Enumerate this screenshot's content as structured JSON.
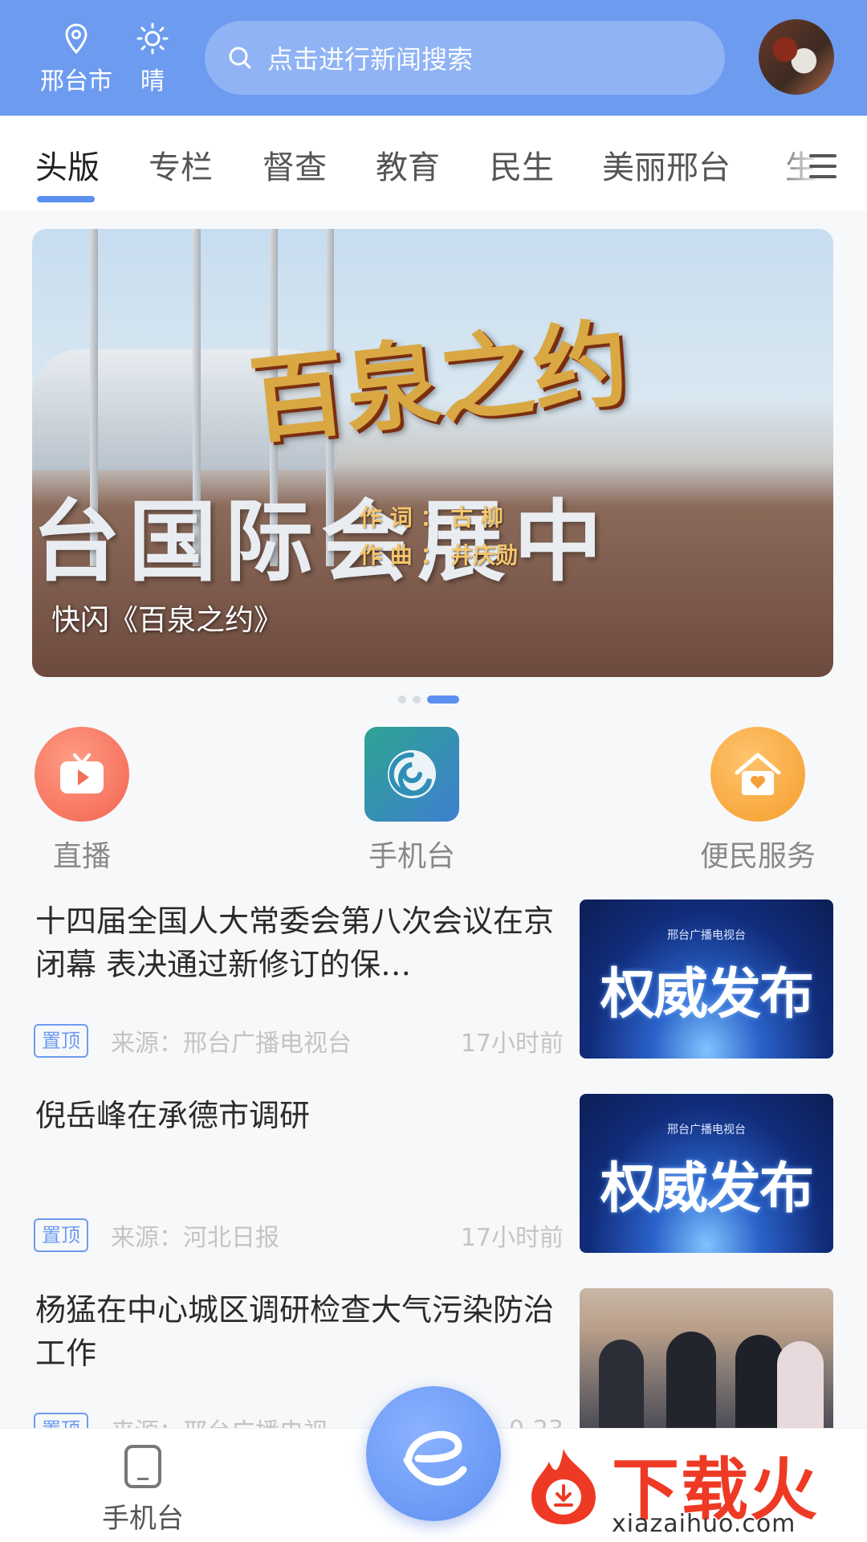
{
  "header": {
    "location_icon": "map-pin-icon",
    "city": "邢台市",
    "weather_icon": "sun-icon",
    "weather": "晴",
    "search_icon": "search-icon",
    "search_placeholder": "点击进行新闻搜索",
    "accent_color": "#6d9bf0"
  },
  "tabs": {
    "items": [
      {
        "label": "头版",
        "active": true
      },
      {
        "label": "专栏"
      },
      {
        "label": "督查"
      },
      {
        "label": "教育"
      },
      {
        "label": "民生"
      },
      {
        "label": "美丽邢台"
      },
      {
        "label": "生"
      }
    ],
    "menu_icon": "menu-icon"
  },
  "banner": {
    "headline_art": "百泉之约",
    "sign_art": "台国际会展中",
    "credit_lyrics": "作 词 ： 古 柳",
    "credit_music": "作 曲 ： 井庆勋",
    "caption": "快闪《百泉之约》",
    "slide_count": 3,
    "active_slide": 3
  },
  "shortcuts": [
    {
      "label": "直播",
      "icon": "tv-play-icon"
    },
    {
      "label": "手机台",
      "icon": "spiral-app-icon"
    },
    {
      "label": "便民服务",
      "icon": "house-heart-icon"
    }
  ],
  "news": [
    {
      "title": "十四届全国人大常委会第八次会议在京闭幕 表决通过新修订的保…",
      "badge": "置顶",
      "source": "来源：邢台广播电视台",
      "time": "17小时前",
      "thumb_logo": "邢台广播电视台",
      "thumb_text": "权威发布"
    },
    {
      "title": "倪岳峰在承德市调研",
      "badge": "置顶",
      "source": "来源：河北日报",
      "time": "17小时前",
      "thumb_logo": "邢台广播电视台",
      "thumb_text": "权威发布"
    },
    {
      "title": "杨猛在中心城区调研检查大气污染防治工作",
      "badge": "置顶",
      "source": "来源：邢台广播电视",
      "time": "0-23"
    }
  ],
  "bottom_nav": {
    "items": [
      {
        "label": "手机台",
        "icon": "phone-icon"
      }
    ],
    "center_icon": "e-logo-icon"
  },
  "watermark": {
    "text": "下载火",
    "url": "xiazaihuo.com",
    "color": "#ee3a24"
  }
}
